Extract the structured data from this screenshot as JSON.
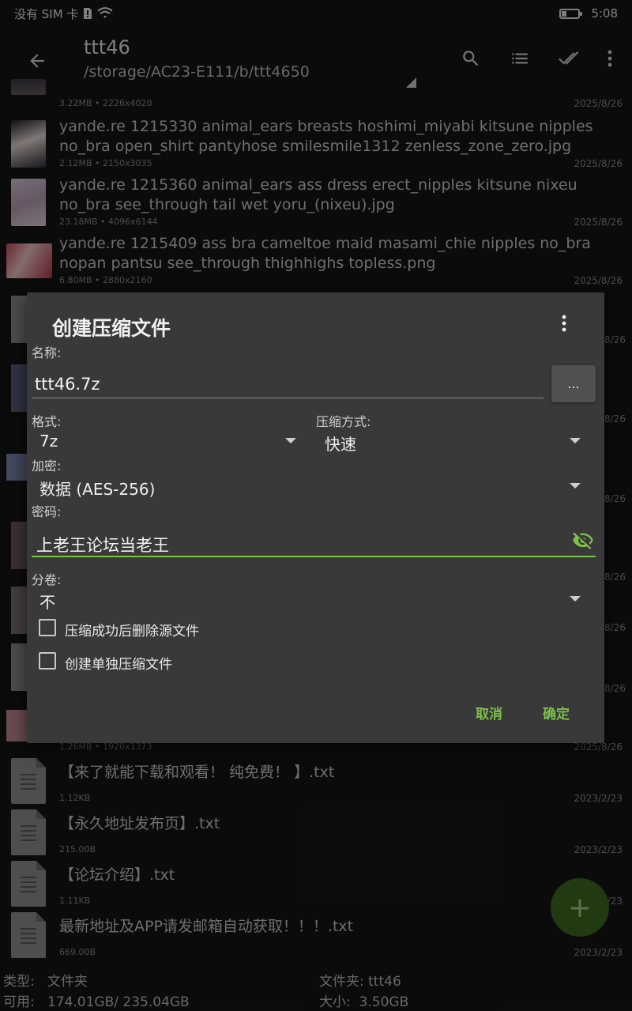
{
  "status_bar": {
    "carrier": "没有 SIM 卡",
    "time": "5:08"
  },
  "toolbar": {
    "title": "ttt46",
    "path": "/storage/AC23-E111/b/ttt4650"
  },
  "files": [
    {
      "name": "",
      "size": "3.22MB",
      "dims": "2226x4020",
      "date": "2025/8/26"
    },
    {
      "name": "yande.re 1215330 animal_ears breasts hoshimi_miyabi kitsune nipples no_bra open_shirt pantyhose smilesmile1312 zenless_zone_zero.jpg",
      "size": "2.12MB",
      "dims": "2150x3035",
      "date": "2025/8/26"
    },
    {
      "name": "yande.re 1215360 animal_ears ass dress erect_nipples kitsune nixeu no_bra see_through tail wet yoru_(nixeu).jpg",
      "size": "23.18MB",
      "dims": "4096x6144",
      "date": "2025/8/26"
    },
    {
      "name": "yande.re 1215409 ass bra cameltoe maid masami_chie nipples no_bra nopan pantsu see_through thighhighs topless.png",
      "size": "6.80MB",
      "dims": "2880x2160",
      "date": "2025/8/26"
    },
    {
      "name": "",
      "size": "1.26MB",
      "dims": "1920x1373",
      "date": "2025/8/26"
    }
  ],
  "hidden_dates": [
    "8/26",
    "8/26",
    "8/26",
    "8/26",
    "8/26",
    "8/26"
  ],
  "txt_files": [
    {
      "name": "【来了就能下载和观看！ 纯免费！ 】.txt",
      "size": "1.12KB",
      "date": "2023/2/23"
    },
    {
      "name": "【永久地址发布页】.txt",
      "size": "215.00B",
      "date": "2023/2/23"
    },
    {
      "name": "【论坛介绍】.txt",
      "size": "1.11KB",
      "date": "2023/2/23"
    },
    {
      "name": "最新地址及APP请发邮箱自动获取！！！.txt",
      "size": "669.00B",
      "date": "2023/2/23"
    }
  ],
  "infobar": {
    "type_label": "类型:",
    "type_value": "文件夹",
    "free_label": "可用:",
    "free_value": "174.01GB/ 235.04GB",
    "folder_label": "文件夹:",
    "folder_value": "ttt46",
    "size_label": "大小:",
    "size_value": "3.50GB"
  },
  "fab": {
    "label": "+"
  },
  "dialog": {
    "title": "创建压缩文件",
    "name_label": "名称:",
    "name_value": "ttt46.7z",
    "browse_label": "...",
    "format_label": "格式:",
    "format_value": "7z",
    "method_label": "压缩方式:",
    "method_value": "快速",
    "encryption_label": "加密:",
    "encryption_value": "数据 (AES-256)",
    "password_label": "密码:",
    "password_value": "上老王论坛当老王",
    "volume_label": "分卷:",
    "volume_value": "不",
    "delete_after_label": "压缩成功后删除源文件",
    "delete_after_checked": false,
    "separate_label": "创建单独压缩文件",
    "separate_checked": false,
    "cancel_label": "取消",
    "ok_label": "确定",
    "accent_color": "#7cc04a"
  }
}
